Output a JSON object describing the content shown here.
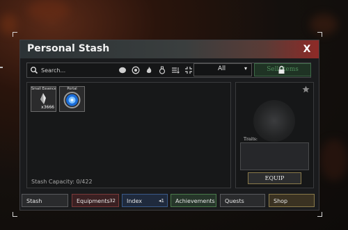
{
  "window": {
    "title": "Personal Stash",
    "close_label": "X"
  },
  "search": {
    "placeholder": "Search..."
  },
  "filters": [
    "circle-filter-icon",
    "armor-filter-icon",
    "fire-filter-icon",
    "potion-filter-icon",
    "sort-list-icon",
    "collapse-icon"
  ],
  "sort": {
    "selected": "All",
    "chevron": "▾"
  },
  "sell": {
    "label": "Sell Items"
  },
  "items": [
    {
      "name": "Small Essence",
      "qty": "x3666"
    },
    {
      "name": "Portal",
      "qty": ""
    }
  ],
  "capacity": "Stash Capacity: 0/422",
  "detail": {
    "traits_label": "Traits:",
    "equip_label": "EQUIP"
  },
  "tabs": [
    {
      "label": "Stash",
      "count": ""
    },
    {
      "label": "Equipments",
      "count": "32"
    },
    {
      "label": "Index",
      "count": "1"
    },
    {
      "label": "Achievements",
      "count": ""
    },
    {
      "label": "Quests",
      "count": ""
    },
    {
      "label": "Shop",
      "count": ""
    }
  ]
}
